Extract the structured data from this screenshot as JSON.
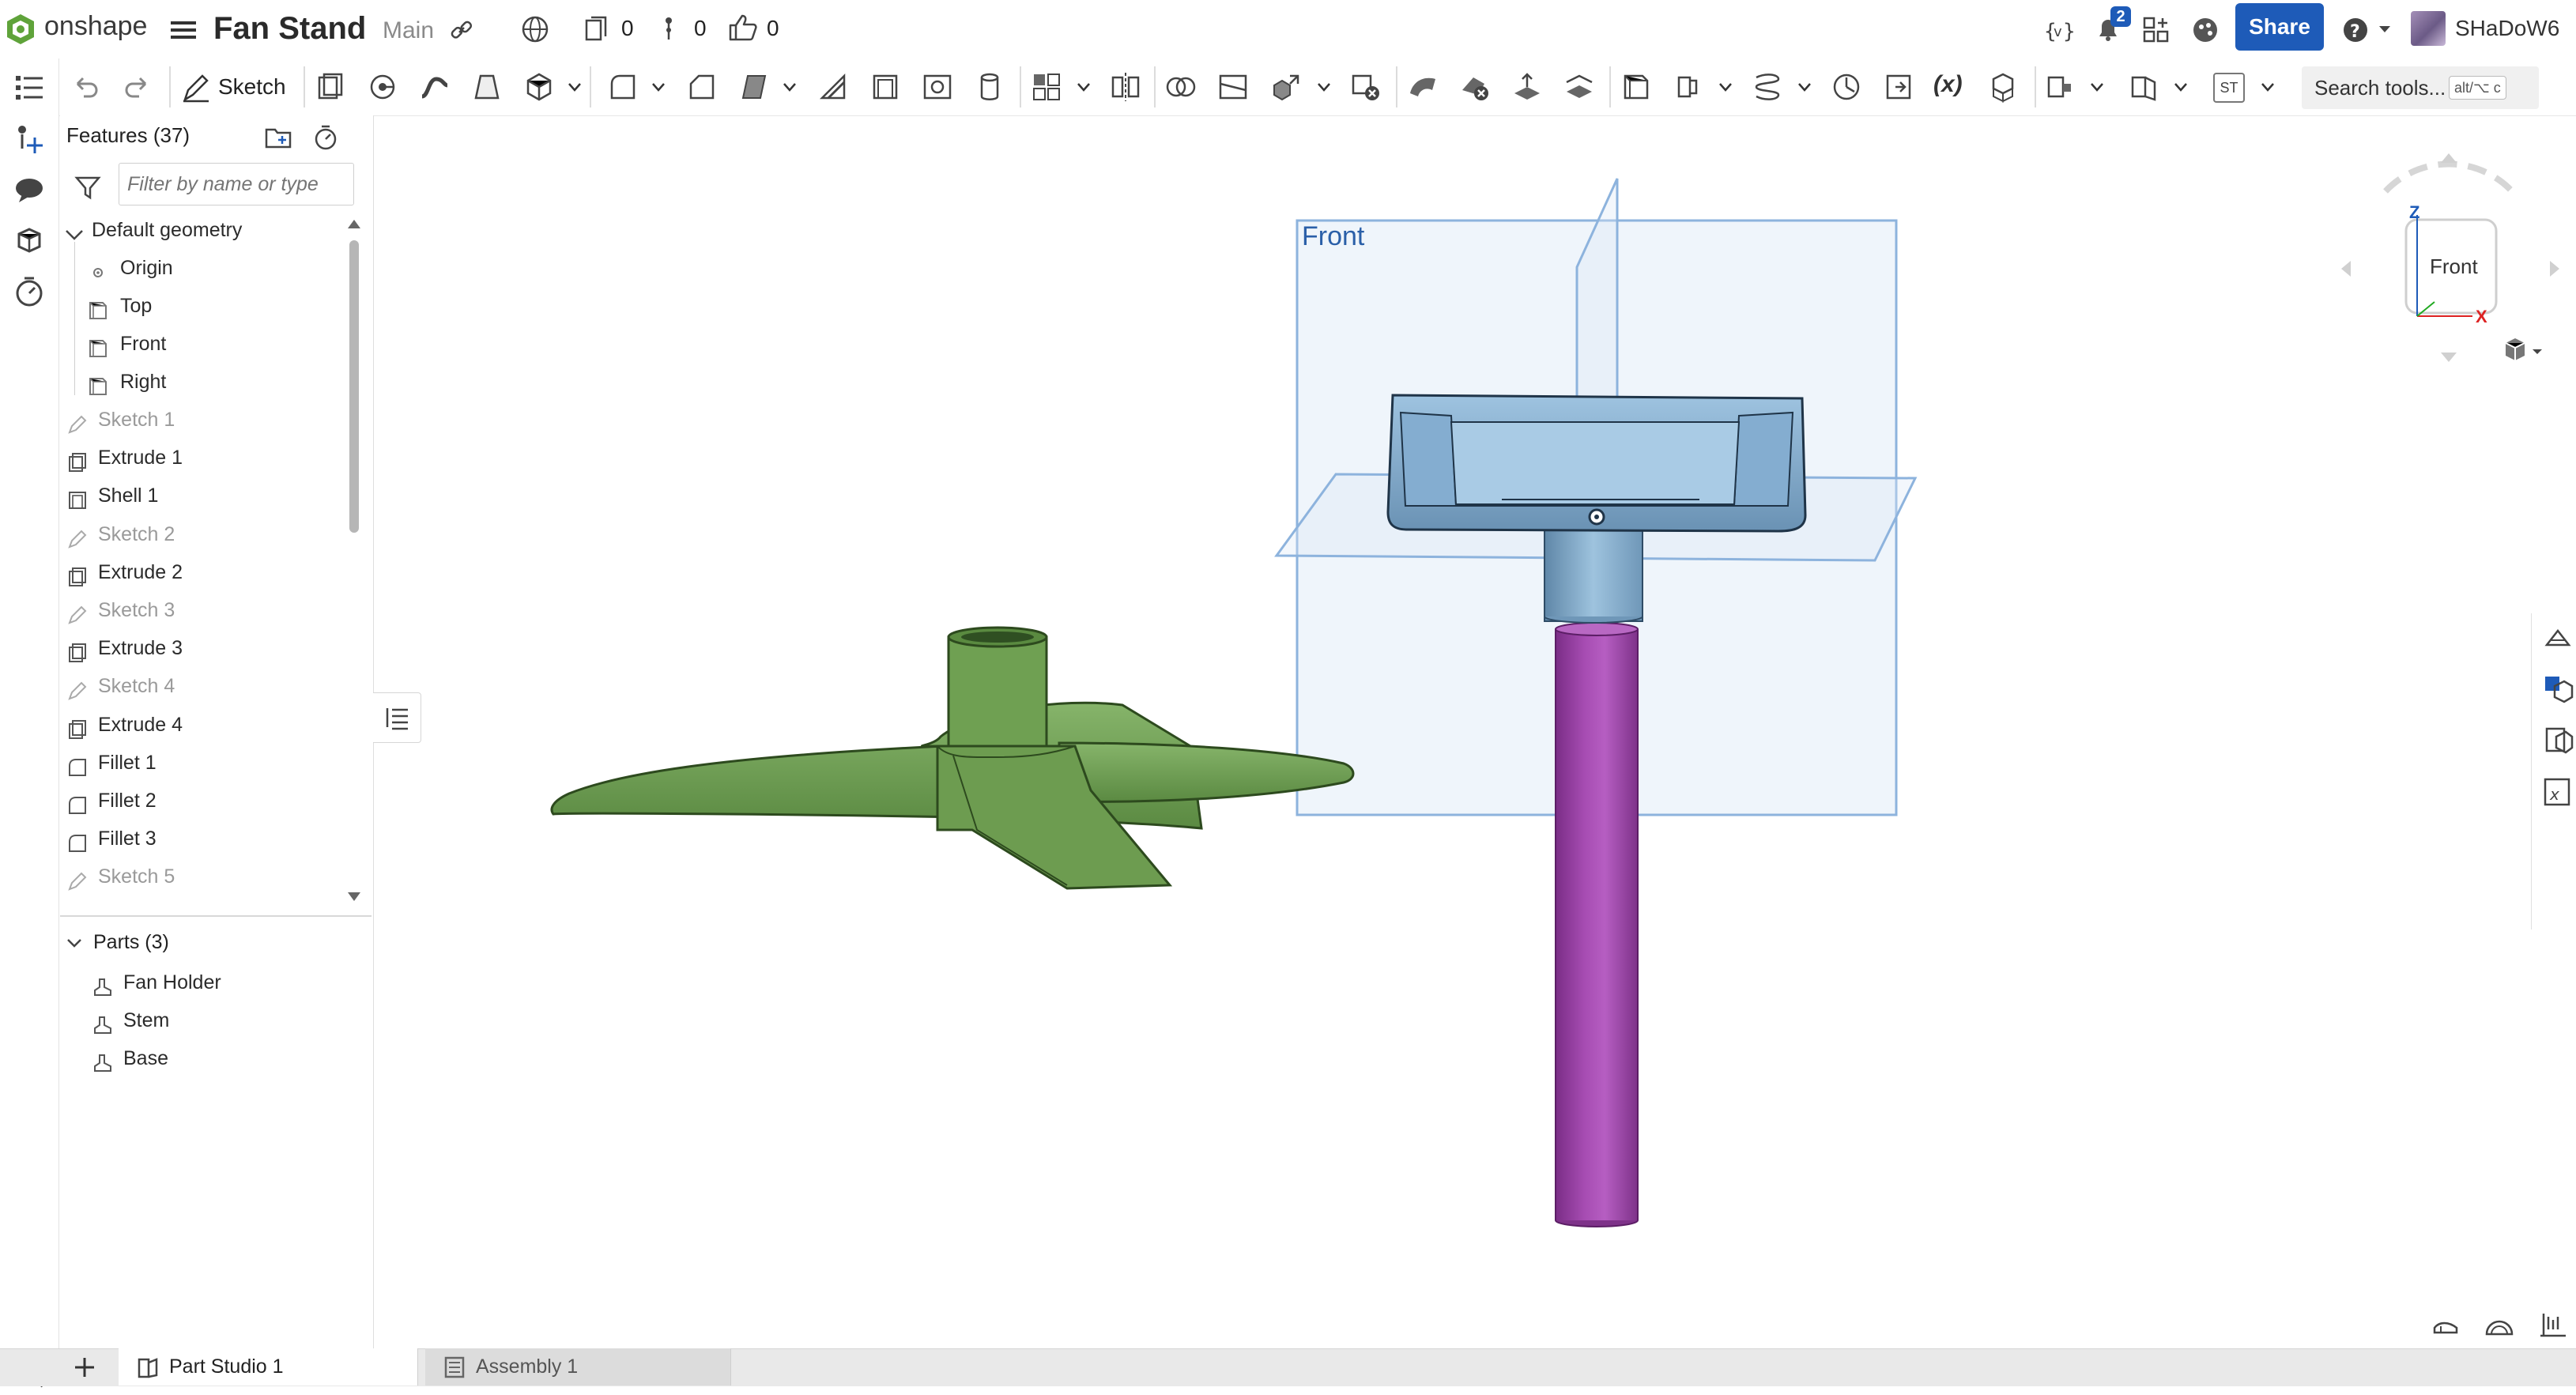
{
  "app": {
    "brand": "onshape",
    "document_title": "Fan Stand",
    "workspace": "Main",
    "counts": {
      "versions": "0",
      "branches": "0",
      "likes": "0"
    },
    "notifications": "2",
    "share_label": "Share",
    "username": "SHaDoW6"
  },
  "toolbar": {
    "sketch_label": "Sketch",
    "search_label": "Search tools...",
    "search_shortcut": "alt/⌥ c",
    "st_badge": "ST",
    "variable_label": "(x)"
  },
  "panel": {
    "features_title": "Features (37)",
    "filter_placeholder": "Filter by name or type",
    "default_geometry": "Default geometry",
    "geometry_items": [
      "Origin",
      "Top",
      "Front",
      "Right"
    ],
    "features": [
      {
        "label": "Sketch 1",
        "kind": "sketch"
      },
      {
        "label": "Extrude 1",
        "kind": "extrude"
      },
      {
        "label": "Shell 1",
        "kind": "shell"
      },
      {
        "label": "Sketch 2",
        "kind": "sketch"
      },
      {
        "label": "Extrude 2",
        "kind": "extrude"
      },
      {
        "label": "Sketch 3",
        "kind": "sketch"
      },
      {
        "label": "Extrude 3",
        "kind": "extrude"
      },
      {
        "label": "Sketch 4",
        "kind": "sketch"
      },
      {
        "label": "Extrude 4",
        "kind": "extrude"
      },
      {
        "label": "Fillet 1",
        "kind": "fillet"
      },
      {
        "label": "Fillet 2",
        "kind": "fillet"
      },
      {
        "label": "Fillet 3",
        "kind": "fillet"
      },
      {
        "label": "Sketch 5",
        "kind": "sketch"
      }
    ],
    "parts_title": "Parts (3)",
    "parts": [
      "Fan Holder",
      "Stem",
      "Base"
    ]
  },
  "viewport": {
    "plane_label": "Front",
    "view_cube_face": "Front",
    "axis_labels": {
      "z": "Z",
      "x": "X"
    },
    "part_colors": {
      "base": "#6fa052",
      "holder": "#7fa8c8",
      "stem": "#9b3fa6"
    }
  },
  "bottom": {
    "tabs": [
      "Part Studio 1",
      "Assembly 1"
    ]
  },
  "colors": {
    "accent": "#1e5bb8",
    "plane_fill": "#dce9f6",
    "plane_edge": "#8db3dd"
  }
}
